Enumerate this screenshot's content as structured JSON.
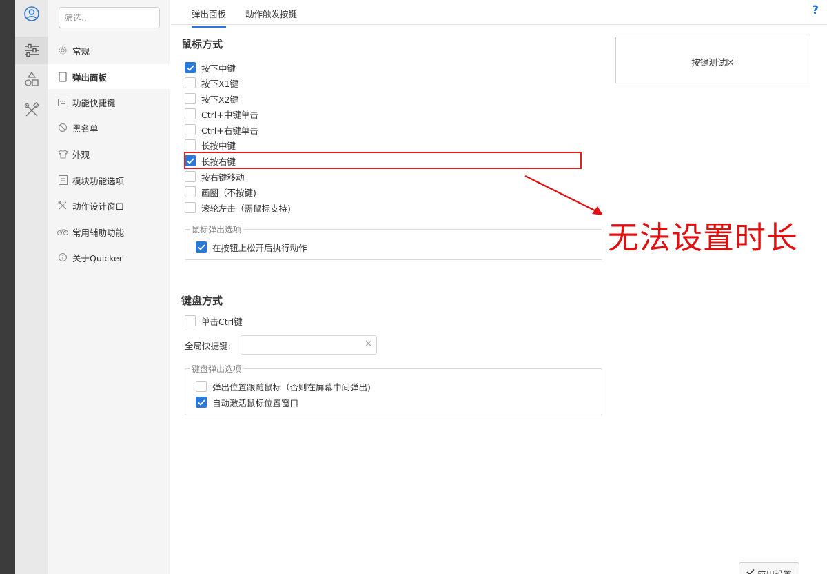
{
  "sidebar": {
    "filter_placeholder": "筛选...",
    "items": [
      {
        "label": "常规",
        "icon": "gear-icon"
      },
      {
        "label": "弹出面板",
        "icon": "panel-icon",
        "active": true
      },
      {
        "label": "功能快捷键",
        "icon": "keyboard-icon"
      },
      {
        "label": "黑名单",
        "icon": "ban-icon"
      },
      {
        "label": "外观",
        "icon": "shirt-icon"
      },
      {
        "label": "模块功能选项",
        "icon": "module-icon"
      },
      {
        "label": "动作设计窗口",
        "icon": "tools-icon"
      },
      {
        "label": "常用辅助功能",
        "icon": "bike-icon"
      },
      {
        "label": "关于Quicker",
        "icon": "info-icon"
      }
    ]
  },
  "tabs": [
    {
      "label": "弹出面板",
      "active": true
    },
    {
      "label": "动作触发按键",
      "active": false
    }
  ],
  "help_label": "?",
  "mouse": {
    "title": "鼠标方式",
    "options": [
      {
        "label": "按下中键",
        "checked": true
      },
      {
        "label": "按下X1键",
        "checked": false
      },
      {
        "label": "按下X2键",
        "checked": false
      },
      {
        "label": "Ctrl+中键单击",
        "checked": false
      },
      {
        "label": "Ctrl+右键单击",
        "checked": false
      },
      {
        "label": "长按中键",
        "checked": false
      },
      {
        "label": "长按右键",
        "checked": true
      },
      {
        "label": "按右键移动",
        "checked": false
      },
      {
        "label": "画圈（不按键)",
        "checked": false
      },
      {
        "label": "滚轮左击（需鼠标支持)",
        "checked": false
      }
    ],
    "group_legend": "鼠标弹出选项",
    "group_options": [
      {
        "label": "在按钮上松开后执行动作",
        "checked": true
      }
    ]
  },
  "test_area_label": "按键测试区",
  "keyboard": {
    "title": "键盘方式",
    "single_ctrl": {
      "label": "单击Ctrl键",
      "checked": false
    },
    "hotkey_label": "全局快捷键:",
    "hotkey_value": "",
    "hotkey_clear": "×",
    "group_legend": "键盘弹出选项",
    "group_options": [
      {
        "label": "弹出位置跟随鼠标（否则在屏幕中间弹出)",
        "checked": false
      },
      {
        "label": "自动激活鼠标位置窗口",
        "checked": true
      }
    ]
  },
  "annotation": "无法设置时长",
  "apply_label": "应用设置",
  "colors": {
    "accent": "#2b78d8",
    "annotation": "#e01010"
  }
}
